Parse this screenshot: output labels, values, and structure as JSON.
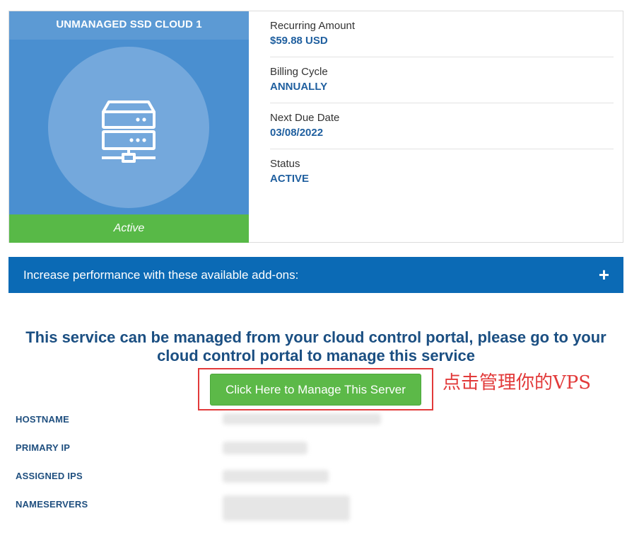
{
  "product": {
    "title": "UNMANAGED SSD CLOUD 1",
    "status": "Active",
    "icon": "server-icon"
  },
  "info": [
    {
      "label": "Recurring Amount",
      "value": "$59.88 USD"
    },
    {
      "label": "Billing Cycle",
      "value": "ANNUALLY"
    },
    {
      "label": "Next Due Date",
      "value": "03/08/2022"
    },
    {
      "label": "Status",
      "value": "ACTIVE"
    }
  ],
  "addons": {
    "text": "Increase performance with these available add-ons:",
    "toggle": "+"
  },
  "message": "This service can be managed from your cloud control portal, please go to your cloud control portal to manage this service",
  "manage_button": "Click Here to Manage This Server",
  "annotation": "点击管理你的VPS",
  "details": [
    {
      "label": "HOSTNAME"
    },
    {
      "label": "PRIMARY IP"
    },
    {
      "label": "ASSIGNED IPS"
    },
    {
      "label": "NAMESERVERS"
    }
  ],
  "colors": {
    "product_panel": "#4a8fd0",
    "status_green": "#58b947",
    "addons_blue": "#0b6ab5",
    "value_blue": "#1f5f9f",
    "annotation_red": "#e23a3a"
  }
}
